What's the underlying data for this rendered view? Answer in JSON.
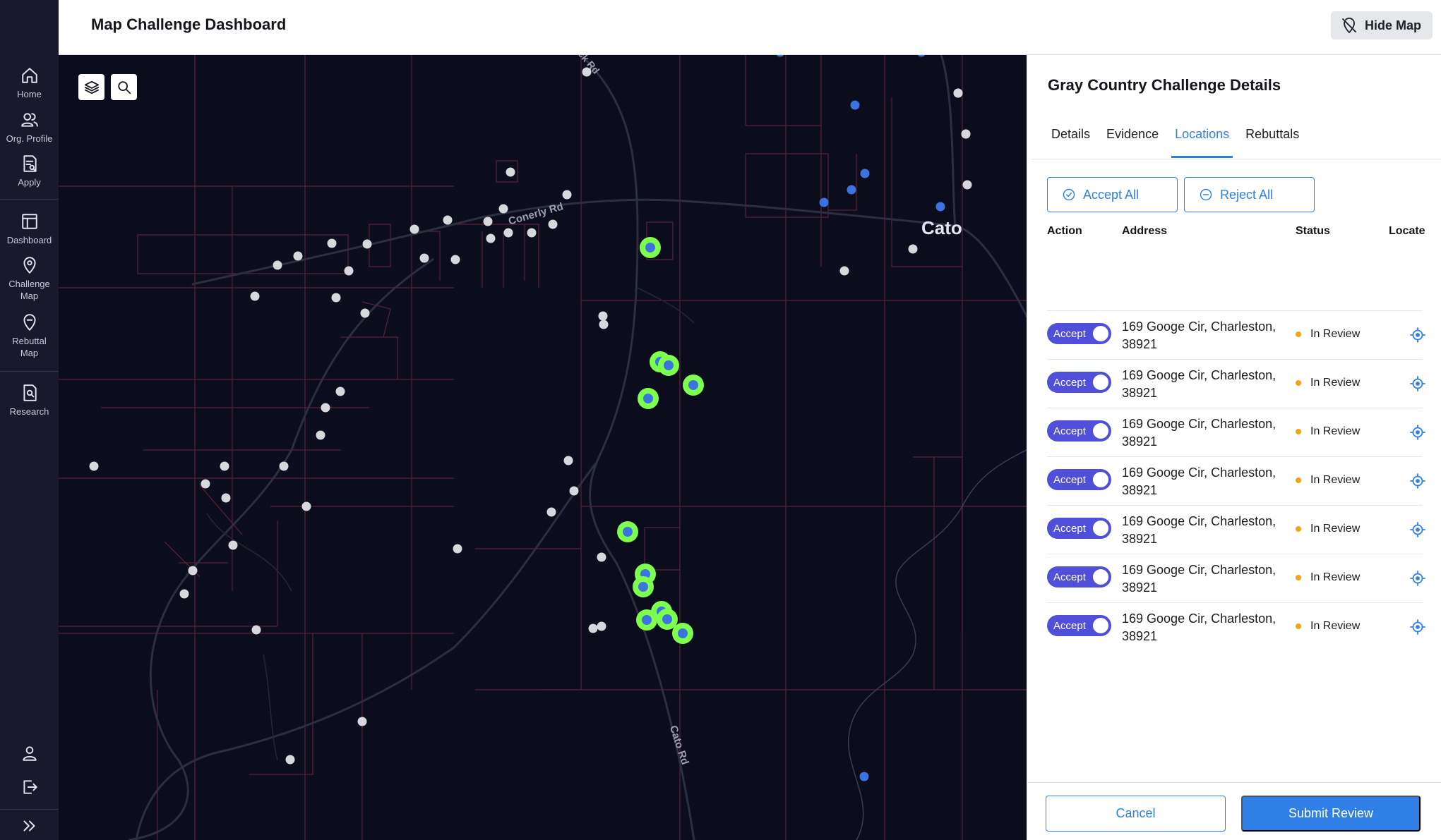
{
  "header": {
    "title": "Map Challenge Dashboard",
    "hide_map_label": "Hide Map"
  },
  "sidebar": {
    "items": [
      {
        "label": "Home",
        "icon": "home-icon"
      },
      {
        "label": "Org. Profile",
        "icon": "users-icon"
      },
      {
        "label": "Apply",
        "icon": "apply-icon"
      },
      {
        "label": "Dashboard",
        "icon": "dashboard-icon"
      },
      {
        "label": "Challenge\nMap",
        "icon": "map-pin-icon"
      },
      {
        "label": "Rebuttal\nMap",
        "icon": "rebuttal-pin-icon"
      },
      {
        "label": "Research",
        "icon": "research-icon"
      }
    ],
    "bottom_icons": [
      "user-icon",
      "logout-icon",
      "expand-icon"
    ]
  },
  "map": {
    "place_label": "Cato",
    "road_labels": [
      "Conerly Rd",
      "Cato Rd",
      "ck Rd"
    ],
    "tools": [
      "layers-icon",
      "search-icon"
    ]
  },
  "panel": {
    "title": "Gray Country Challenge Details",
    "tabs": [
      {
        "label": "Details",
        "active": false
      },
      {
        "label": "Evidence",
        "active": false
      },
      {
        "label": "Locations",
        "active": true
      },
      {
        "label": "Rebuttals",
        "active": false
      }
    ],
    "accept_all_label": "Accept All",
    "reject_all_label": "Reject All",
    "columns": {
      "action": "Action",
      "address": "Address",
      "status": "Status",
      "locate": "Locate"
    },
    "rows": [
      {
        "toggle": "Accept",
        "address": "169 Googe Cir, Charleston, 38921",
        "status": "In Review"
      },
      {
        "toggle": "Accept",
        "address": "169 Googe Cir, Charleston, 38921",
        "status": "In Review"
      },
      {
        "toggle": "Accept",
        "address": "169 Googe Cir, Charleston, 38921",
        "status": "In Review"
      },
      {
        "toggle": "Accept",
        "address": "169 Googe Cir, Charleston, 38921",
        "status": "In Review"
      },
      {
        "toggle": "Accept",
        "address": "169 Googe Cir, Charleston, 38921",
        "status": "In Review"
      },
      {
        "toggle": "Accept",
        "address": "169 Googe Cir, Charleston, 38921",
        "status": "In Review"
      },
      {
        "toggle": "Accept",
        "address": "169 Googe Cir, Charleston, 38921",
        "status": "In Review"
      }
    ],
    "cancel_label": "Cancel",
    "submit_label": "Submit Review"
  },
  "colors": {
    "accent": "#2f7fe6",
    "toggle": "#4f4fd9",
    "status_in_review": "#f5a316",
    "map_background": "#0b0d1c",
    "challenge_marker": "#7dff4d",
    "sidebar": "#181a2c"
  }
}
